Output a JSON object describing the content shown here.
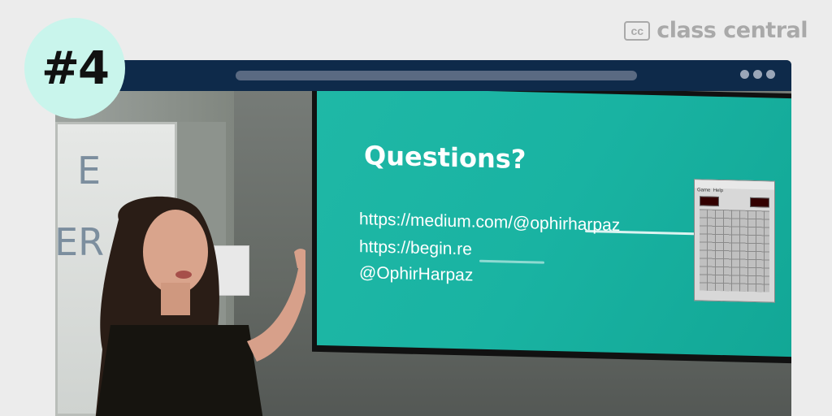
{
  "badge": {
    "label": "#4"
  },
  "brand": {
    "logo_text": "cc",
    "name": "class central"
  },
  "slide": {
    "title": "Questions?",
    "links": [
      "https://medium.com/@ophirharpaz",
      "https://begin.re",
      "@OphirHarpaz"
    ],
    "minesweeper_menu": [
      "Game",
      "Help"
    ]
  },
  "whiteboard": {
    "handwriting": [
      "E",
      "ER"
    ]
  },
  "colors": {
    "badge_bg": "#c9f5ec",
    "titlebar": "#0e2a4a",
    "slide_bg": "#1fb8a6",
    "brand_gray": "#a9a9a9"
  },
  "icons": [
    "class-central-logo-icon",
    "window-dots-icon",
    "minesweeper-window-icon"
  ]
}
